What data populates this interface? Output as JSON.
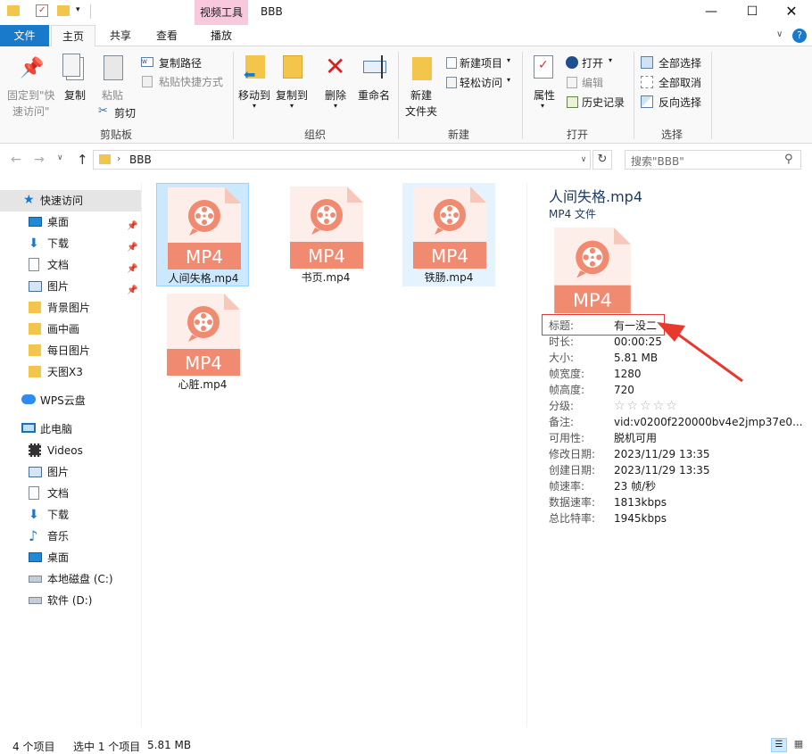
{
  "window": {
    "context_tab": "视频工具",
    "title": "BBB"
  },
  "tabs": {
    "file": "文件",
    "home": "主页",
    "share": "共享",
    "view": "查看",
    "play": "播放"
  },
  "ribbon": {
    "clipboard": {
      "pin_line1": "固定到\"快",
      "pin_line2": "速访问\"",
      "copy": "复制",
      "paste": "粘贴",
      "copy_path": "复制路径",
      "paste_shortcut": "粘贴快捷方式",
      "cut": "剪切",
      "group_label": "剪贴板"
    },
    "organize": {
      "move_to": "移动到",
      "copy_to": "复制到",
      "delete": "删除",
      "rename": "重命名",
      "group_label": "组织"
    },
    "new": {
      "new_folder_line1": "新建",
      "new_folder_line2": "文件夹",
      "new_item": "新建项目",
      "easy_access": "轻松访问",
      "group_label": "新建"
    },
    "open": {
      "properties": "属性",
      "open": "打开",
      "edit": "编辑",
      "history": "历史记录",
      "group_label": "打开"
    },
    "select": {
      "select_all": "全部选择",
      "select_none": "全部取消",
      "invert": "反向选择",
      "group_label": "选择"
    }
  },
  "address": {
    "path": "BBB",
    "search_placeholder": "搜索\"BBB\""
  },
  "sidebar": {
    "quick_access": "快速访问",
    "quick_items": [
      {
        "label": "桌面",
        "icon": "desktop-icon",
        "pinned": true
      },
      {
        "label": "下载",
        "icon": "download-icon",
        "pinned": true
      },
      {
        "label": "文档",
        "icon": "document-icon",
        "pinned": true
      },
      {
        "label": "图片",
        "icon": "picture-icon",
        "pinned": true
      },
      {
        "label": "背景图片",
        "icon": "folder-icon",
        "pinned": false
      },
      {
        "label": "画中画",
        "icon": "folder-icon",
        "pinned": false
      },
      {
        "label": "每日图片",
        "icon": "folder-icon",
        "pinned": false
      },
      {
        "label": "天图X3",
        "icon": "folder-icon",
        "pinned": false
      }
    ],
    "wps": "WPS云盘",
    "this_pc": "此电脑",
    "pc_items": [
      {
        "label": "Videos",
        "icon": "video-folder-icon"
      },
      {
        "label": "图片",
        "icon": "picture-icon"
      },
      {
        "label": "文档",
        "icon": "document-icon"
      },
      {
        "label": "下载",
        "icon": "download-icon"
      },
      {
        "label": "音乐",
        "icon": "music-icon"
      },
      {
        "label": "桌面",
        "icon": "desktop-icon"
      },
      {
        "label": "本地磁盘 (C:)",
        "icon": "drive-c-icon"
      },
      {
        "label": "软件 (D:)",
        "icon": "drive-d-icon"
      }
    ]
  },
  "files": {
    "badge": "MP4",
    "items": [
      {
        "name": "人间失格.mp4",
        "state": "selected"
      },
      {
        "name": "书页.mp4",
        "state": "normal"
      },
      {
        "name": "铁肠.mp4",
        "state": "hover"
      },
      {
        "name": "心脏.mp4",
        "state": "normal"
      }
    ]
  },
  "details": {
    "filename": "人间失格.mp4",
    "filetype": "MP4 文件",
    "badge": "MP4",
    "props": [
      {
        "k": "标题:",
        "v": "有一没二"
      },
      {
        "k": "时长:",
        "v": "00:00:25"
      },
      {
        "k": "大小:",
        "v": "5.81 MB"
      },
      {
        "k": "帧宽度:",
        "v": "1280"
      },
      {
        "k": "帧高度:",
        "v": "720"
      },
      {
        "k": "分级:",
        "v": "☆☆☆☆☆"
      },
      {
        "k": "备注:",
        "v": "vid:v0200f220000bv4e2jmp37e0..."
      },
      {
        "k": "可用性:",
        "v": "脱机可用"
      },
      {
        "k": "修改日期:",
        "v": "2023/11/29 13:35"
      },
      {
        "k": "创建日期:",
        "v": "2023/11/29 13:35"
      },
      {
        "k": "帧速率:",
        "v": "23 帧/秒"
      },
      {
        "k": "数据速率:",
        "v": "1813kbps"
      },
      {
        "k": "总比特率:",
        "v": "1945kbps"
      }
    ]
  },
  "status": {
    "count": "4 个项目",
    "selected": "选中 1 个项目",
    "size": "5.81 MB"
  },
  "colors": {
    "accent": "#1979ca",
    "mp4_body": "#f08a70",
    "highlight_box": "#e03a3a",
    "arrow": "#e8392f",
    "context_tab": "#f8c8dc"
  }
}
